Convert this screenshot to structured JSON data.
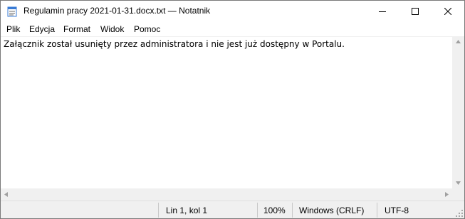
{
  "window": {
    "title": "Regulamin pracy 2021-01-31.docx.txt — Notatnik",
    "app_icon": "notepad-icon",
    "controls": {
      "minimize_icon": "minimize-icon",
      "maximize_icon": "maximize-icon",
      "close_icon": "close-icon"
    }
  },
  "menu": {
    "items": [
      "Plik",
      "Edycja",
      "Format",
      "Widok",
      "Pomoc"
    ]
  },
  "editor": {
    "content": "Załącznik został usunięty przez administratora i nie jest już dostępny w Portalu."
  },
  "statusbar": {
    "position": "Lin 1, kol 1",
    "zoom": "100%",
    "line_ending": "Windows (CRLF)",
    "encoding": "UTF-8"
  },
  "colors": {
    "chrome": "#f0f0f0",
    "text": "#000000",
    "background": "#ffffff"
  }
}
